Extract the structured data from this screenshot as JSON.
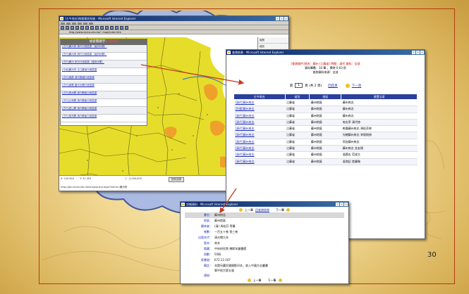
{
  "slide": {
    "page_number": "30"
  },
  "gis_window": {
    "title": "[古今地名]地理資訊系統 - Microsoft Internet Explorer",
    "address": "http://www.sinica.edu.tw/~map/index.htm",
    "panel": {
      "title_prefix": "檢索關鍵字：",
      "title_keyword": "蘇州府",
      "rows": [
        "[古代]蘇州府 清代行政區劃（省府州縣）",
        "[古代]蘇州府 明代行政區劃（省府州縣）",
        "[古代]蘇州 宋代行政區劃（路府州軍）",
        "[今地]蘇州市 今江蘇省行政區劃",
        "[古代]吳郡 漢代郡國行政區劃",
        "[古代]吳縣 唐代州縣行政區劃",
        "[古代]長洲縣 清代縣級行政區劃",
        "[古代]元和縣 清代縣級行政區劃",
        "[古代]崑山縣 清代縣級行政區劃",
        "[古代]常熟縣 清代縣級行政區劃"
      ]
    },
    "sidebar": [
      "圖層",
      "縮放",
      "查詢",
      "列印",
      "說明"
    ],
    "status": {
      "coord_lon": "X: 120.610",
      "coord_lat": "Y: 31.303",
      "scale": "1 : 2,000,000",
      "button": "回到全圖",
      "url": "http://gis.sinica.edu.tw/map/query.aspx?name=蘇州府"
    }
  },
  "results_window": {
    "title": "查詢結果 - Microsoft Internet Explorer",
    "query_line": "[查詢條件]地名：蘇州 (江蘇省) 時間：清代 資料：全部",
    "count_line": "資料筆數：10 筆 ，費時 0.03 秒",
    "source_line": "查詢資料來源：全部",
    "pager": {
      "prefix": "第",
      "page": "1",
      "suffix": "頁 (共 2 頁)",
      "link": "回首頁",
      "next": "下一頁"
    },
    "table": {
      "headers": [
        "古今地名",
        "省別",
        "地區",
        "建置沿革"
      ],
      "rows": [
        [
          "[清代]蘇州府志",
          "江蘇省",
          "蘇州地區",
          "蘇州府志"
        ],
        [
          "[民國]蘇州府志",
          "江蘇省",
          "蘇州地區",
          "蘇州府志"
        ],
        [
          "[清代]蘇州府志",
          "江蘇省",
          "蘇州地區",
          "蘇州府志"
        ],
        [
          "[清代]蘇州府志",
          "江蘇省",
          "蘇州地區",
          "府志序 清代修"
        ],
        [
          "[清代]蘇州府志",
          "江蘇省",
          "蘇州地區",
          "乾隆蘇州府志 馮桂芬修"
        ],
        [
          "[清代]蘇州府志",
          "江蘇省",
          "蘇州地區",
          "光緒蘇州府志 李銘皖修"
        ],
        [
          "[清代]蘇州府志",
          "江蘇省",
          "蘇州地區",
          "同治蘇州府志"
        ],
        [
          "[清代]蘇州府志",
          "江蘇省",
          "蘇州地區",
          "蘇州府志 金友理"
        ],
        [
          "[清代]蘇州府志",
          "江蘇省",
          "蘇州地區",
          "吳郡志 范成大"
        ],
        [
          "[清代]蘇州府志",
          "江蘇省",
          "蘇州地區",
          "吳地記 陸廣微"
        ]
      ]
    }
  },
  "detail_window": {
    "title": "詳細資料 - Microsoft Internet Explorer",
    "nav_top": {
      "prev": "上一筆",
      "back": "回查詢結果",
      "next": "下一筆"
    },
    "fields": [
      {
        "k": "書名：",
        "v": "蘇州府志"
      },
      {
        "k": "地區：",
        "v": "蘇州地區"
      },
      {
        "k": "纂修者：",
        "v": "(清) 馮桂芬 等纂"
      },
      {
        "k": "卷數：",
        "v": "一百五十卷 首三卷"
      },
      {
        "k": "出版年代：",
        "v": "清光緒九年"
      },
      {
        "k": "版本：",
        "v": "刻本"
      },
      {
        "k": "館藏：",
        "v": "中央研究院 傅斯年圖書館"
      },
      {
        "k": "冊數：",
        "v": "50冊"
      },
      {
        "k": "索書號：",
        "v": "672.13 167"
      },
      {
        "k": "備註：",
        "v": "本館另藏民國間影印本，收入中國方志叢書"
      },
      {
        "k": "",
        "v": "華中地方第五號"
      },
      {
        "k": "連結：",
        "v": ""
      }
    ],
    "nav_bottom": {
      "prev": "上一筆",
      "next": "下一筆"
    }
  },
  "colors": {
    "frame": "#b73a12",
    "arrow": "#c43a1e",
    "title_bar": "#0a246a",
    "table_header": "#2a3f9e",
    "map_yellow": "#e5dd2a"
  }
}
